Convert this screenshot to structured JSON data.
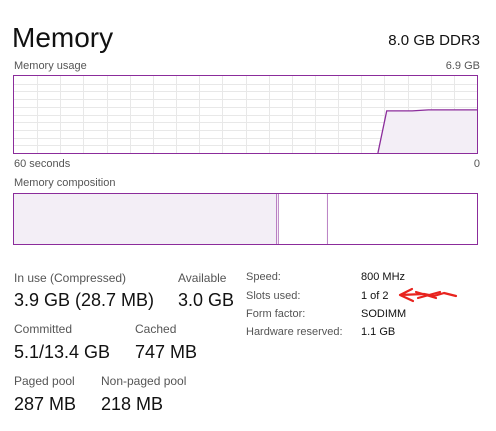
{
  "header": {
    "title": "Memory",
    "spec": "8.0 GB DDR3"
  },
  "usage_graph": {
    "label": "Memory usage",
    "max_label": "6.9 GB",
    "left_time_label": "60 seconds",
    "right_time_label": "0",
    "line_color": "#8b2c9b",
    "fill_color": "#f3eef6",
    "grid_color": "#e8e8e8",
    "usage_fraction_recent": 0.56
  },
  "composition_graph": {
    "label": "Memory composition",
    "in_use_fraction": 0.567,
    "modified_fraction": 0.004,
    "standby_fraction": 0.106,
    "fill_color": "#f3eef6",
    "border_color": "#8b2c9b"
  },
  "stats": {
    "in_use_label": "In use (Compressed)",
    "in_use_value": "3.9 GB (28.7 MB)",
    "available_label": "Available",
    "available_value": "3.0 GB",
    "committed_label": "Committed",
    "committed_value": "5.1/13.4 GB",
    "cached_label": "Cached",
    "cached_value": "747 MB",
    "paged_pool_label": "Paged pool",
    "paged_pool_value": "287 MB",
    "non_paged_pool_label": "Non-paged pool",
    "non_paged_pool_value": "218 MB"
  },
  "properties": {
    "speed_label": "Speed:",
    "speed_value": "800 MHz",
    "slots_label": "Slots used:",
    "slots_value": "1 of 2",
    "form_factor_label": "Form factor:",
    "form_factor_value": "SODIMM",
    "hw_reserved_label": "Hardware reserved:",
    "hw_reserved_value": "1.1 GB"
  },
  "annotation": {
    "arrow_color": "#e8231e"
  }
}
